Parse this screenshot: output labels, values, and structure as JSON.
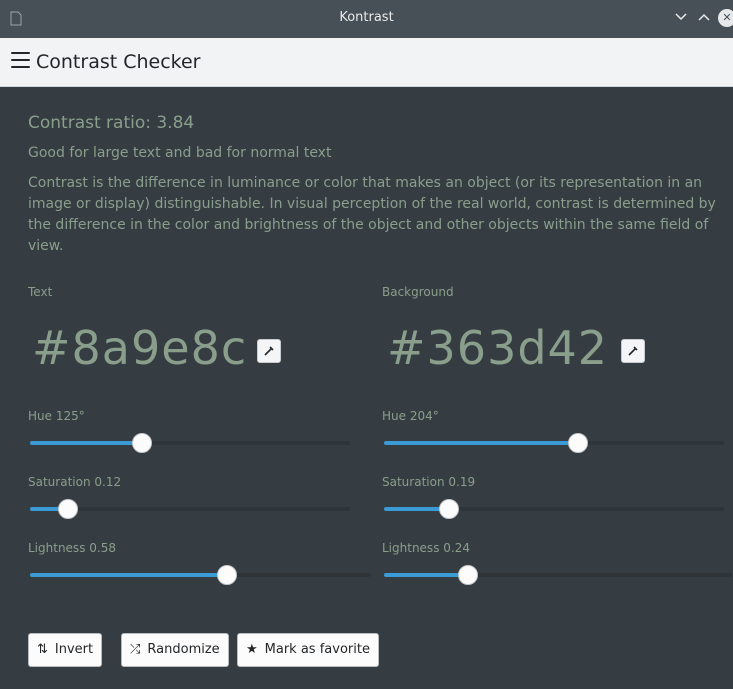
{
  "window": {
    "title": "Kontrast",
    "controls": {
      "minimize_icon": "chevron-down-icon",
      "maximize_icon": "chevron-up-icon",
      "close_icon": "close-icon"
    }
  },
  "header": {
    "title": "Contrast Checker",
    "menu_icon": "hamburger-menu-icon"
  },
  "main": {
    "ratio": "Contrast ratio: 3.84",
    "verdict": "Good for large text and bad for normal text",
    "description": "Contrast is the difference in luminance or color that makes an object (or its representation in an image or display) distinguishable. In visual perception of the real world, contrast is determined by the difference in the color and brightness of the object and other objects within the same field of view."
  },
  "text_color": {
    "label": "Text",
    "hex": "#8a9e8c",
    "hue": {
      "label": "Hue 125°",
      "fraction": 0.35
    },
    "saturation": {
      "label": "Saturation 0.12",
      "fraction": 0.12
    },
    "lightness": {
      "label": "Lightness 0.58",
      "fraction": 0.58
    }
  },
  "background_color": {
    "label": "Background",
    "hex": "#363d42",
    "hue": {
      "label": "Hue 204°",
      "fraction": 0.57
    },
    "saturation": {
      "label": "Saturation 0.19",
      "fraction": 0.19
    },
    "lightness": {
      "label": "Lightness 0.24",
      "fraction": 0.24
    }
  },
  "actions": {
    "invert": "Invert",
    "randomize": "Randomize",
    "favorite": "Mark as favorite"
  },
  "colors": {
    "accent": "#3b9bd6",
    "text": "#8a9e8c",
    "background": "#363d42"
  }
}
